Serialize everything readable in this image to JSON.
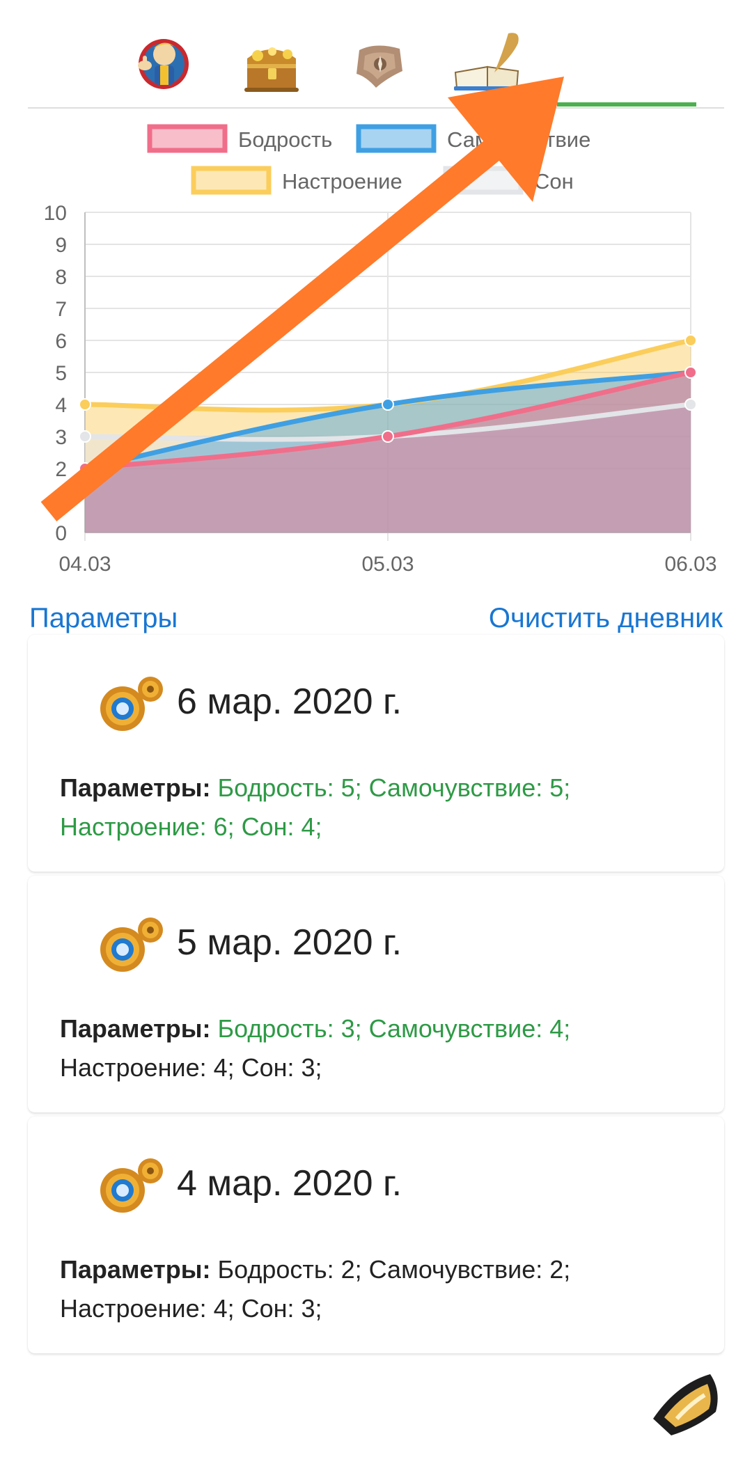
{
  "tabs": [
    {
      "icon": "vault-boy-icon"
    },
    {
      "icon": "treasure-chest-icon"
    },
    {
      "icon": "map-scroll-icon"
    },
    {
      "icon": "diary-quill-icon",
      "active": true
    }
  ],
  "chart_data": {
    "type": "area",
    "categories": [
      "04.03",
      "05.03",
      "06.03"
    ],
    "series": [
      {
        "name": "Бодрость",
        "values": [
          2,
          3,
          5
        ],
        "color": "#f06e8a"
      },
      {
        "name": "Самочувствие",
        "values": [
          2,
          4,
          5
        ],
        "color": "#3f9fe3"
      },
      {
        "name": "Настроение",
        "values": [
          4,
          4,
          6
        ],
        "color": "#fbcd5b"
      },
      {
        "name": "Сон",
        "values": [
          3,
          3,
          4
        ],
        "color": "#e3e5e8"
      }
    ],
    "y_ticks": [
      "0",
      "2",
      "3",
      "4",
      "5",
      "6",
      "7",
      "8",
      "9",
      "10"
    ],
    "ylim": [
      0,
      10
    ],
    "legend_position": "top",
    "grid": true
  },
  "links": {
    "params": "Параметры",
    "clear": "Очистить дневник"
  },
  "entries": [
    {
      "date": "6 мар. 2020 г.",
      "label": "Параметры:",
      "green": "Бодрость: 5; Самочувствие: 5; Настроение: 6; Сон: 4;",
      "plain": ""
    },
    {
      "date": "5 мар. 2020 г.",
      "label": "Параметры:",
      "green": "Бодрость: 3; Самочувствие: 4;",
      "plain": "Настроение: 4; Сон: 3;"
    },
    {
      "date": "4 мар. 2020 г.",
      "label": "Параметры:",
      "green": "",
      "plain": "Бодрость: 2; Самочувствие: 2; Настроение: 4; Сон: 3;"
    }
  ],
  "colors": {
    "accent_link": "#1976d2",
    "active_tab": "#4caf50",
    "green_text": "#2e9a46",
    "arrow": "#ff7a2a"
  },
  "fab": {
    "icon": "quill-fab-icon"
  }
}
